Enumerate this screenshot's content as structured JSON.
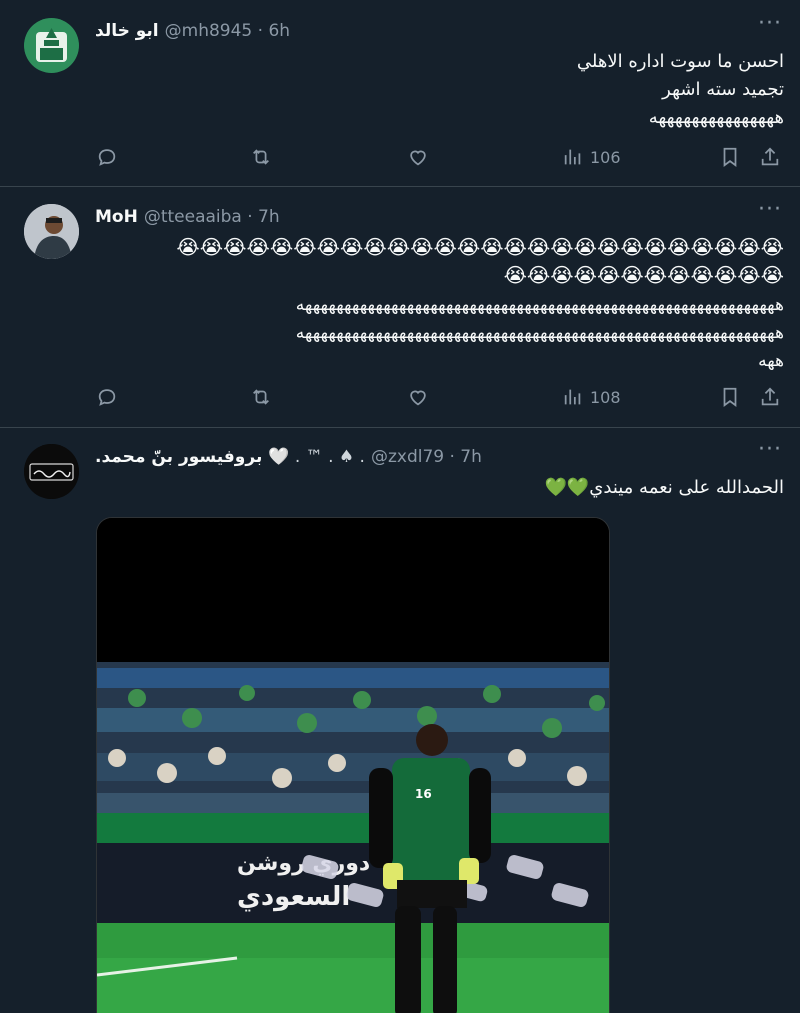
{
  "tweets": [
    {
      "name": "ابو خالد",
      "handle": "@mh8945 · 6h",
      "lines": [
        "احسن ما سوت اداره الاهلي",
        "تجميد سته اشهر",
        "هههههههههههههههه"
      ],
      "views": "106",
      "avatar_icon": "club-crest-avatar"
    },
    {
      "name": "MoH",
      "handle": "@tteeaaiba · 7h",
      "emoji_line1": "😭😭😭😭😭😭😭😭😭😭😭😭😭😭😭😭😭😭😭😭😭😭😭😭😭😭",
      "emoji_line2": "😭😭😭😭😭😭😭😭😭😭😭😭",
      "laugh_line1": "هههههههههههههههههههههههههههههههههههههههههههههههههههههههههههههه",
      "laugh_line2": "هههههههههههههههههههههههههههههههههههههههههههههههههههههههههههههه",
      "laugh_line3": "ههه",
      "views": "108",
      "avatar_icon": "user-photo-avatar"
    },
    {
      "name": ".بروفيسور بنّ محمد",
      "handle_prefix": "🤍 . ™ . ♠ .",
      "handle": "@zxdl79 · 7h",
      "text": "الحمدالله على نعمه ميندي💚💚",
      "avatar_icon": "calligraphy-avatar",
      "media_sign_line1": "دوري روشن",
      "media_sign_line2": "السعودي",
      "media_jersey_number": "16"
    }
  ],
  "colors": {
    "background": "#15202b",
    "divider": "#38444d",
    "muted": "#8b98a5",
    "text": "#f7f9f9"
  },
  "icons": [
    "reply-icon",
    "retweet-icon",
    "like-icon",
    "views-icon",
    "bookmark-icon",
    "share-icon",
    "more-icon"
  ]
}
